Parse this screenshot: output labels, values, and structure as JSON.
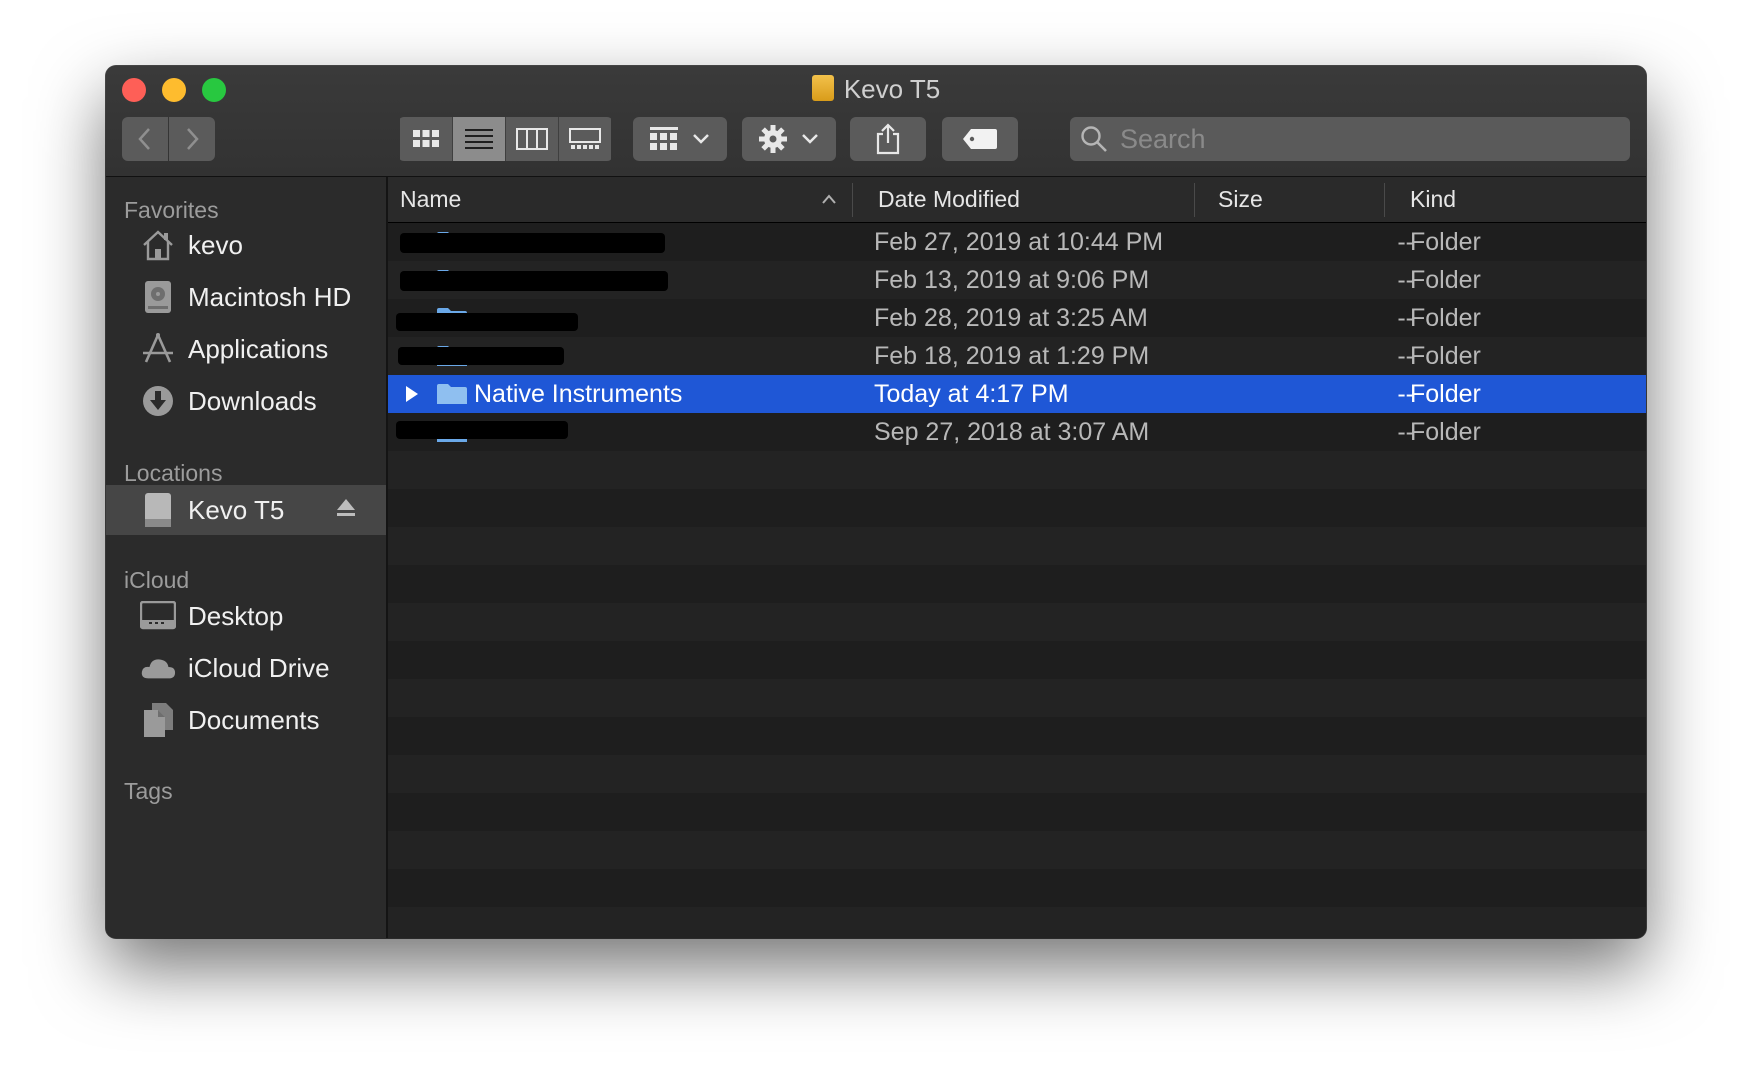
{
  "window": {
    "title": "Kevo T5",
    "colors": {
      "close": "#fe5f57",
      "minimize": "#febc2e",
      "maximize": "#28c840",
      "selection": "#1f57d6"
    }
  },
  "toolbar": {
    "search_placeholder": "Search",
    "view_modes": [
      "icon-view",
      "list-view",
      "column-view",
      "gallery-view"
    ],
    "active_view": "list-view"
  },
  "sidebar": {
    "favorites_label": "Favorites",
    "favorites": [
      {
        "label": "kevo",
        "icon": "home-icon"
      },
      {
        "label": "Macintosh HD",
        "icon": "hard-drive-icon"
      },
      {
        "label": "Applications",
        "icon": "applications-icon"
      },
      {
        "label": "Downloads",
        "icon": "downloads-icon"
      }
    ],
    "locations_label": "Locations",
    "locations": [
      {
        "label": "Kevo T5",
        "icon": "external-drive-icon"
      }
    ],
    "icloud_label": "iCloud",
    "icloud": [
      {
        "label": "Desktop",
        "icon": "desktop-icon"
      },
      {
        "label": "iCloud Drive",
        "icon": "cloud-icon"
      },
      {
        "label": "Documents",
        "icon": "documents-icon"
      }
    ],
    "tags_label": "Tags"
  },
  "list": {
    "headers": {
      "name": "Name",
      "date": "Date Modified",
      "size": "Size",
      "kind": "Kind"
    },
    "rows": [
      {
        "name": "",
        "date": "Feb 27, 2019 at 10:44 PM",
        "size": "--",
        "kind": "Folder",
        "redacted": true
      },
      {
        "name": "",
        "date": "Feb 13, 2019 at 9:06 PM",
        "size": "--",
        "kind": "Folder",
        "redacted": true
      },
      {
        "name": "",
        "date": "Feb 28, 2019 at 3:25 AM",
        "size": "--",
        "kind": "Folder",
        "redacted": true
      },
      {
        "name": "",
        "date": "Feb 18, 2019 at 1:29 PM",
        "size": "--",
        "kind": "Folder",
        "redacted": true
      },
      {
        "name": "Native Instruments",
        "date": "Today at 4:17 PM",
        "size": "--",
        "kind": "Folder",
        "selected": true
      },
      {
        "name": "",
        "date": "Sep 27, 2018 at 3:07 AM",
        "size": "--",
        "kind": "Folder",
        "redacted": true
      }
    ]
  }
}
